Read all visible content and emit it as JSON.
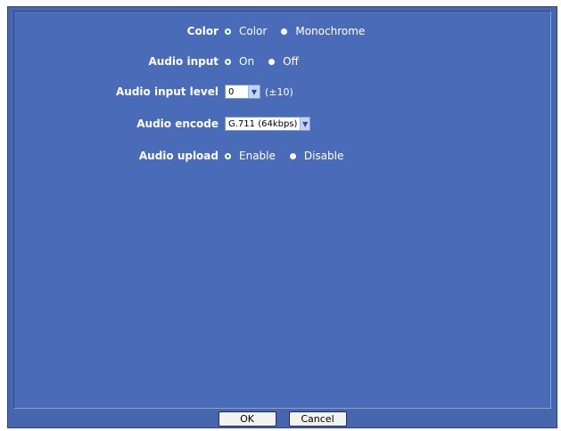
{
  "settings": {
    "color": {
      "label": "Color",
      "options": [
        "Color",
        "Monochrome"
      ],
      "selected": "Color"
    },
    "audio_input": {
      "label": "Audio input",
      "options": [
        "On",
        "Off"
      ],
      "selected": "On"
    },
    "audio_input_level": {
      "label": "Audio input level",
      "value": "0",
      "hint": "(±10)"
    },
    "audio_encode": {
      "label": "Audio encode",
      "value": "G.711 (64kbps)"
    },
    "audio_upload": {
      "label": "Audio upload",
      "options": [
        "Enable",
        "Disable"
      ],
      "selected": "Enable"
    }
  },
  "footer": {
    "ok_label": "OK",
    "cancel_label": "Cancel"
  },
  "colors": {
    "background": "#4a6cb8",
    "text": "#ffffff"
  },
  "icons": {
    "dropdown": "chevron-down-icon"
  }
}
